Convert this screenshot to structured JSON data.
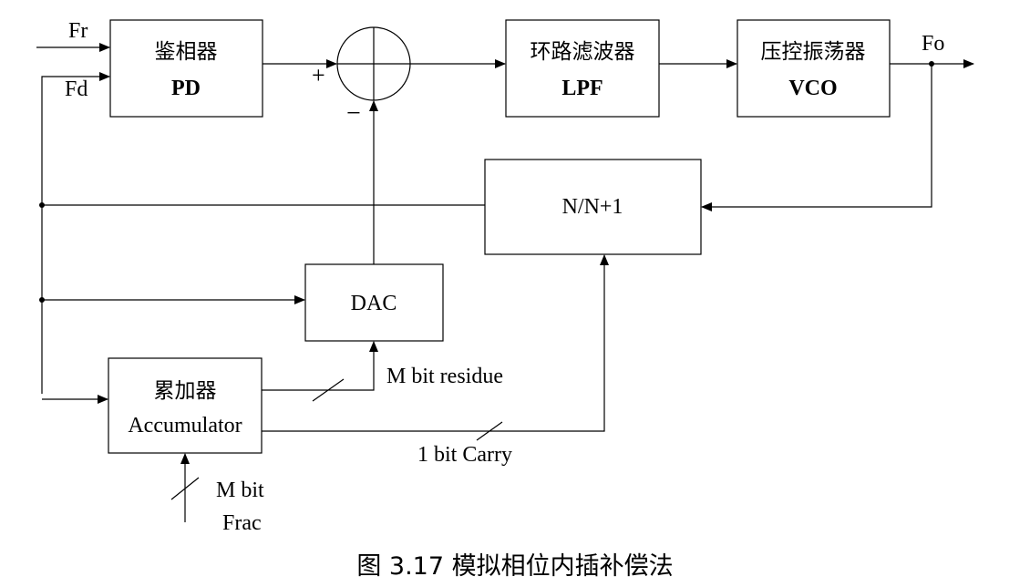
{
  "diagram": {
    "caption": "图 3.17  模拟相位内插补偿法",
    "signals": {
      "fr": "Fr",
      "fd": "Fd",
      "fo": "Fo",
      "plus": "+",
      "minus": "−",
      "m_bit_residue": "M bit residue",
      "one_bit_carry": "1 bit Carry",
      "m_bit": "M bit",
      "frac": "Frac"
    },
    "blocks": {
      "pd": {
        "cn": "鉴相器",
        "en": "PD"
      },
      "lpf": {
        "cn": "环路滤波器",
        "en": "LPF"
      },
      "vco": {
        "cn": "压控振荡器",
        "en": "VCO"
      },
      "divider": {
        "label": "N/N+1"
      },
      "dac": {
        "label": "DAC"
      },
      "accumulator": {
        "cn": "累加器",
        "en": "Accumulator"
      }
    }
  }
}
